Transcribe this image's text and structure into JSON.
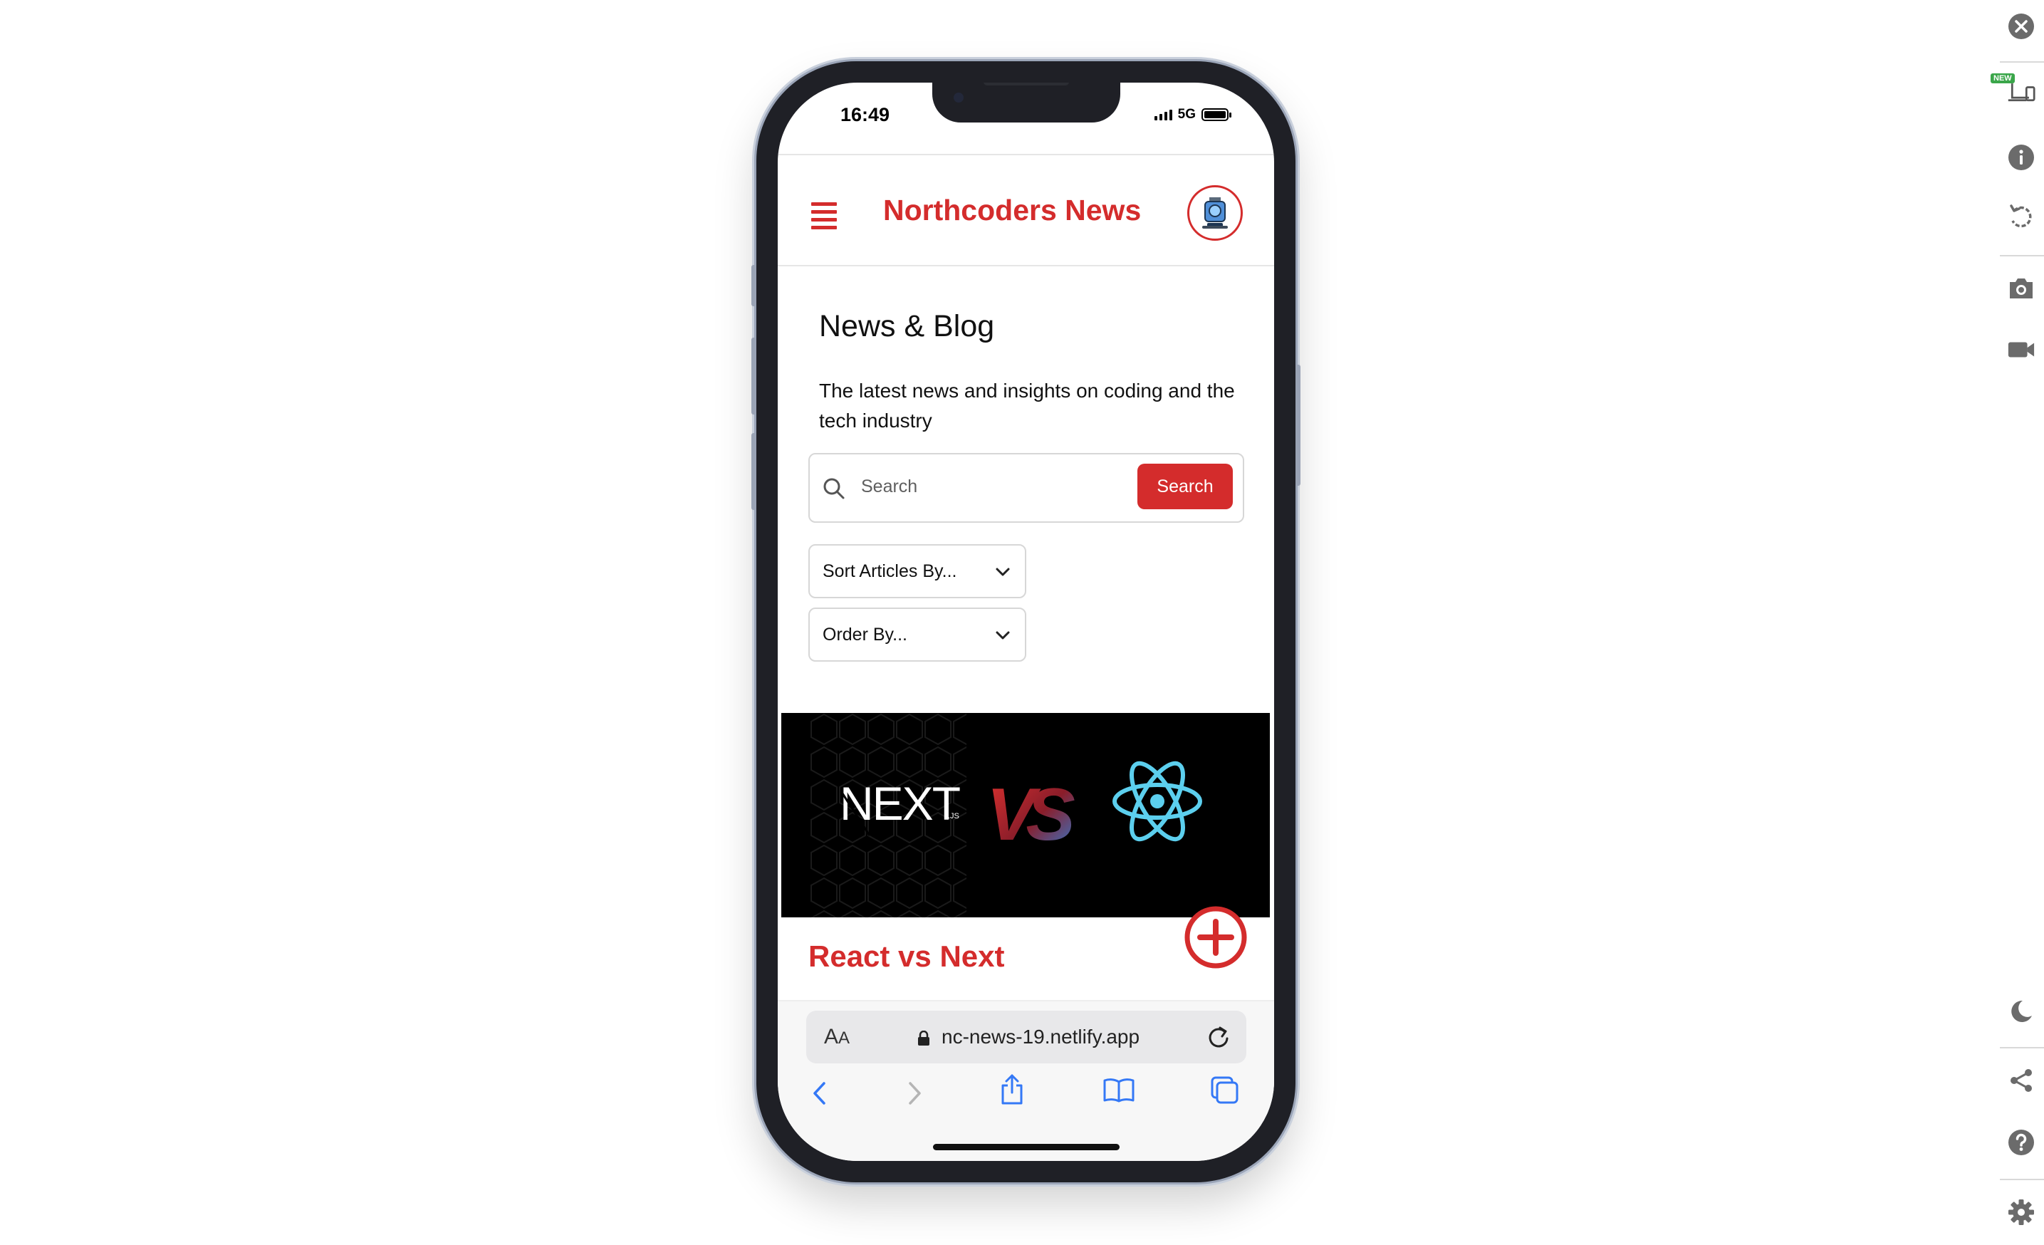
{
  "status": {
    "time": "16:49",
    "network": "5G"
  },
  "app": {
    "brand": "Northcoders News"
  },
  "page": {
    "title": "News & Blog",
    "subtitle": "The latest news and insights on coding and the tech industry"
  },
  "search": {
    "placeholder": "Search",
    "button_label": "Search"
  },
  "filters": {
    "sort_label": "Sort Articles By...",
    "order_label": "Order By..."
  },
  "article": {
    "title": "React vs Next",
    "image_text": "NEXT",
    "image_sub": ".JS",
    "image_vs": "VS"
  },
  "browser": {
    "aa_big": "A",
    "aa_small": "A",
    "url": "nc-news-19.netlify.app"
  },
  "rail": {
    "new_badge": "NEW"
  },
  "colors": {
    "accent": "#d42c2c",
    "react_blue": "#5ccfee",
    "ios_blue": "#3478f6"
  }
}
